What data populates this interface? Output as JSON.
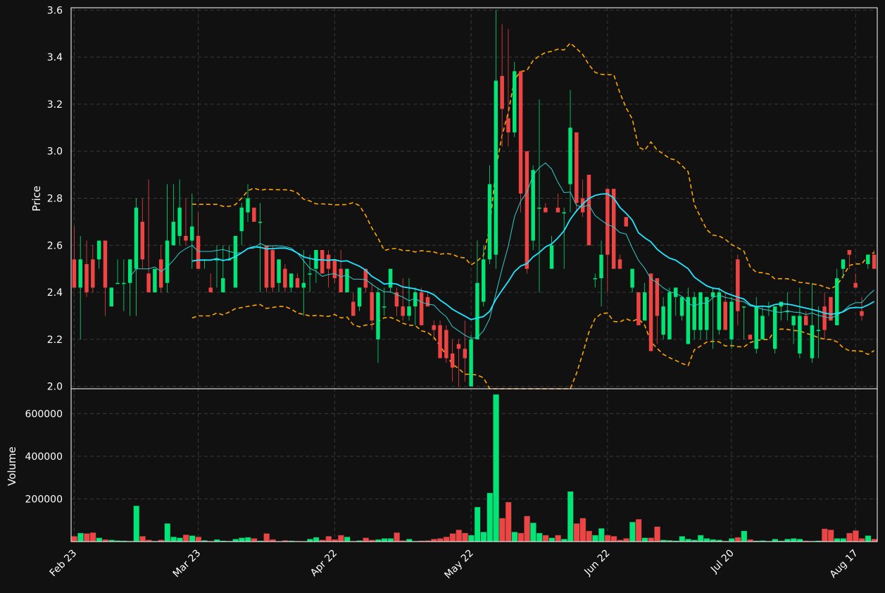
{
  "chart_data": {
    "type": "candlestick",
    "colors": {
      "up": "#00e676",
      "down": "#ef4444",
      "background": "#111111",
      "grid": "#3a3a3a",
      "ma_fast": "#33cccc",
      "ma_slow": "#22e5ff",
      "band": "#ffa500"
    },
    "price_panel": {
      "ylabel": "Price",
      "ylim": [
        1.99,
        3.61
      ],
      "yticks": [
        2.0,
        2.2,
        2.4,
        2.6,
        2.8,
        3.0,
        3.2,
        3.4,
        3.6
      ]
    },
    "volume_panel": {
      "ylabel": "Volume",
      "ylim": [
        0,
        690000
      ],
      "yticks": [
        200000,
        400000,
        600000
      ]
    },
    "x_ticks": [
      {
        "index": 0,
        "label": "Feb 23"
      },
      {
        "index": 20,
        "label": "Mar 23"
      },
      {
        "index": 42,
        "label": "Apr 22"
      },
      {
        "index": 64,
        "label": "May 22"
      },
      {
        "index": 86,
        "label": "Jun 22"
      },
      {
        "index": 106,
        "label": "Jul 20"
      },
      {
        "index": 126,
        "label": "Aug 17"
      }
    ],
    "candles": [
      [
        2.54,
        2.68,
        2.42,
        2.42,
        25000
      ],
      [
        2.42,
        2.64,
        2.2,
        2.54,
        40000
      ],
      [
        2.52,
        2.62,
        2.38,
        2.4,
        38000
      ],
      [
        2.54,
        2.6,
        2.4,
        2.42,
        42000
      ],
      [
        2.54,
        2.62,
        2.5,
        2.62,
        18000
      ],
      [
        2.62,
        2.62,
        2.3,
        2.42,
        10000
      ],
      [
        2.34,
        2.42,
        2.34,
        2.42,
        8000
      ],
      [
        2.44,
        2.54,
        2.44,
        2.44,
        5000
      ],
      [
        2.44,
        2.54,
        2.32,
        2.44,
        4000
      ],
      [
        2.44,
        2.54,
        2.3,
        2.54,
        3000
      ],
      [
        2.5,
        2.8,
        2.3,
        2.76,
        168000
      ],
      [
        2.7,
        2.8,
        2.5,
        2.54,
        25000
      ],
      [
        2.48,
        2.88,
        2.4,
        2.4,
        8000
      ],
      [
        2.4,
        2.5,
        2.4,
        2.5,
        3000
      ],
      [
        2.54,
        2.6,
        2.4,
        2.42,
        8000
      ],
      [
        2.44,
        2.86,
        2.4,
        2.62,
        85000
      ],
      [
        2.6,
        2.86,
        2.6,
        2.7,
        22000
      ],
      [
        2.64,
        2.88,
        2.6,
        2.76,
        18000
      ],
      [
        2.64,
        2.8,
        2.6,
        2.62,
        32000
      ],
      [
        2.62,
        2.82,
        2.5,
        2.68,
        28000
      ],
      [
        2.64,
        2.74,
        2.5,
        2.5,
        22000
      ],
      [
        2.54,
        2.54,
        2.5,
        2.54,
        6000
      ],
      [
        2.42,
        2.48,
        2.4,
        2.4,
        3000
      ],
      [
        2.54,
        2.6,
        2.42,
        2.54,
        10000
      ],
      [
        2.4,
        2.6,
        2.4,
        2.46,
        4000
      ],
      [
        2.54,
        2.6,
        2.54,
        2.54,
        3000
      ],
      [
        2.42,
        2.64,
        2.42,
        2.64,
        12000
      ],
      [
        2.66,
        2.78,
        2.6,
        2.76,
        18000
      ],
      [
        2.74,
        2.86,
        2.7,
        2.8,
        20000
      ],
      [
        2.76,
        2.76,
        2.7,
        2.7,
        15000
      ],
      [
        2.7,
        2.78,
        2.4,
        2.7,
        4000
      ],
      [
        2.6,
        2.6,
        2.4,
        2.42,
        38000
      ],
      [
        2.58,
        2.6,
        2.4,
        2.42,
        10000
      ],
      [
        2.44,
        2.54,
        2.4,
        2.54,
        2000
      ],
      [
        2.5,
        2.52,
        2.4,
        2.42,
        6000
      ],
      [
        2.42,
        2.48,
        2.4,
        2.48,
        4000
      ],
      [
        2.46,
        2.48,
        2.42,
        2.42,
        3000
      ],
      [
        2.42,
        2.58,
        2.3,
        2.44,
        2000
      ],
      [
        2.48,
        2.56,
        2.4,
        2.48,
        12000
      ],
      [
        2.5,
        2.58,
        2.44,
        2.58,
        20000
      ],
      [
        2.58,
        2.58,
        2.48,
        2.48,
        8000
      ],
      [
        2.56,
        2.58,
        2.42,
        2.5,
        25000
      ],
      [
        2.54,
        2.54,
        2.44,
        2.46,
        10000
      ],
      [
        2.5,
        2.58,
        2.4,
        2.4,
        30000
      ],
      [
        2.4,
        2.5,
        2.4,
        2.5,
        22000
      ],
      [
        2.36,
        2.4,
        2.3,
        2.3,
        3000
      ],
      [
        2.34,
        2.42,
        2.32,
        2.42,
        5000
      ],
      [
        2.5,
        2.5,
        2.4,
        2.42,
        18000
      ],
      [
        2.4,
        2.44,
        2.24,
        2.28,
        8000
      ],
      [
        2.2,
        2.42,
        2.1,
        2.4,
        10000
      ],
      [
        2.34,
        2.42,
        2.3,
        2.34,
        15000
      ],
      [
        2.42,
        2.5,
        2.4,
        2.5,
        15000
      ],
      [
        2.4,
        2.42,
        2.3,
        2.34,
        42000
      ],
      [
        2.34,
        2.46,
        2.28,
        2.3,
        5000
      ],
      [
        2.3,
        2.46,
        2.28,
        2.34,
        12000
      ],
      [
        2.34,
        2.42,
        2.26,
        2.4,
        3000
      ],
      [
        2.4,
        2.42,
        2.26,
        2.26,
        4000
      ],
      [
        2.38,
        2.4,
        2.34,
        2.34,
        5000
      ],
      [
        2.26,
        2.28,
        2.2,
        2.24,
        12000
      ],
      [
        2.26,
        2.28,
        2.12,
        2.12,
        15000
      ],
      [
        2.24,
        2.26,
        2.1,
        2.12,
        22000
      ],
      [
        2.14,
        2.2,
        2.02,
        2.08,
        38000
      ],
      [
        2.18,
        2.2,
        2.0,
        2.16,
        55000
      ],
      [
        2.16,
        2.28,
        2.02,
        2.12,
        40000
      ],
      [
        2.0,
        2.22,
        2.0,
        2.2,
        30000
      ],
      [
        2.2,
        2.62,
        2.2,
        2.44,
        162000
      ],
      [
        2.36,
        2.6,
        2.34,
        2.54,
        45000
      ],
      [
        2.54,
        2.94,
        2.52,
        2.86,
        228000
      ],
      [
        2.56,
        3.6,
        2.5,
        3.3,
        690000
      ],
      [
        3.32,
        3.54,
        3.02,
        3.18,
        110000
      ],
      [
        3.14,
        3.52,
        3.02,
        3.08,
        185000
      ],
      [
        3.08,
        3.38,
        3.06,
        3.34,
        45000
      ],
      [
        3.34,
        3.34,
        2.74,
        2.82,
        40000
      ],
      [
        3.0,
        3.0,
        2.48,
        2.5,
        120000
      ],
      [
        2.62,
        2.94,
        2.58,
        2.92,
        88000
      ],
      [
        2.76,
        3.22,
        2.4,
        2.76,
        40000
      ],
      [
        2.76,
        2.78,
        2.74,
        2.74,
        30000
      ],
      [
        2.5,
        2.64,
        2.5,
        2.6,
        18000
      ],
      [
        2.76,
        2.82,
        2.74,
        2.74,
        30000
      ],
      [
        2.74,
        2.76,
        2.5,
        2.74,
        12000
      ],
      [
        2.86,
        3.26,
        2.74,
        3.1,
        235000
      ],
      [
        3.08,
        3.08,
        2.74,
        2.78,
        85000
      ],
      [
        2.8,
        2.88,
        2.72,
        2.74,
        110000
      ],
      [
        2.9,
        2.9,
        2.6,
        2.6,
        50000
      ],
      [
        2.46,
        2.48,
        2.42,
        2.46,
        30000
      ],
      [
        2.46,
        2.62,
        2.34,
        2.56,
        62000
      ],
      [
        2.84,
        2.84,
        2.4,
        2.56,
        30000
      ],
      [
        2.84,
        2.84,
        2.5,
        2.5,
        25000
      ],
      [
        2.54,
        2.56,
        2.5,
        2.5,
        8000
      ],
      [
        2.72,
        2.72,
        2.68,
        2.68,
        15000
      ],
      [
        2.42,
        2.5,
        2.4,
        2.5,
        92000
      ],
      [
        2.4,
        2.4,
        2.32,
        2.26,
        105000
      ],
      [
        2.28,
        2.44,
        2.28,
        2.4,
        18000
      ],
      [
        2.48,
        2.48,
        2.15,
        2.15,
        18000
      ],
      [
        2.46,
        2.46,
        2.18,
        2.3,
        70000
      ],
      [
        2.22,
        2.38,
        2.2,
        2.34,
        8000
      ],
      [
        2.2,
        2.42,
        2.2,
        2.4,
        6000
      ],
      [
        2.38,
        2.42,
        2.3,
        2.42,
        4000
      ],
      [
        2.3,
        2.38,
        2.28,
        2.38,
        25000
      ],
      [
        2.18,
        2.42,
        2.18,
        2.38,
        12000
      ],
      [
        2.24,
        2.4,
        2.2,
        2.38,
        8000
      ],
      [
        2.24,
        2.4,
        2.2,
        2.4,
        30000
      ],
      [
        2.24,
        2.38,
        2.2,
        2.38,
        15000
      ],
      [
        2.38,
        2.42,
        2.16,
        2.4,
        10000
      ],
      [
        2.24,
        2.42,
        2.22,
        2.4,
        8000
      ],
      [
        2.36,
        2.4,
        2.24,
        2.24,
        3000
      ],
      [
        2.2,
        2.38,
        2.16,
        2.36,
        15000
      ],
      [
        2.54,
        2.56,
        2.26,
        2.32,
        20000
      ],
      [
        2.34,
        2.34,
        2.2,
        2.34,
        50000
      ],
      [
        2.22,
        2.2,
        2.2,
        2.2,
        10000
      ],
      [
        2.16,
        2.38,
        2.14,
        2.34,
        4000
      ],
      [
        2.2,
        2.34,
        2.2,
        2.3,
        5000
      ],
      [
        2.34,
        2.36,
        2.3,
        2.34,
        3000
      ],
      [
        2.16,
        2.32,
        2.14,
        2.34,
        12000
      ],
      [
        2.34,
        2.36,
        2.28,
        2.36,
        4000
      ],
      [
        2.32,
        2.4,
        2.28,
        2.32,
        12000
      ],
      [
        2.26,
        2.3,
        2.18,
        2.3,
        15000
      ],
      [
        2.14,
        2.42,
        2.12,
        2.3,
        12000
      ],
      [
        2.3,
        2.32,
        2.26,
        2.26,
        4000
      ],
      [
        2.12,
        2.44,
        2.1,
        2.26,
        3000
      ],
      [
        2.24,
        2.34,
        2.12,
        2.24,
        4000
      ],
      [
        2.34,
        2.4,
        2.2,
        2.24,
        60000
      ],
      [
        2.38,
        2.38,
        2.32,
        2.28,
        55000
      ],
      [
        2.26,
        2.5,
        2.26,
        2.46,
        15000
      ],
      [
        2.5,
        2.54,
        2.46,
        2.54,
        15000
      ],
      [
        2.58,
        2.58,
        2.5,
        2.56,
        40000
      ],
      [
        2.44,
        2.48,
        2.44,
        2.42,
        52000
      ],
      [
        2.32,
        2.38,
        2.28,
        2.3,
        15000
      ],
      [
        2.52,
        2.56,
        2.5,
        2.56,
        28000
      ],
      [
        2.56,
        2.58,
        2.5,
        2.5,
        12000
      ]
    ]
  }
}
